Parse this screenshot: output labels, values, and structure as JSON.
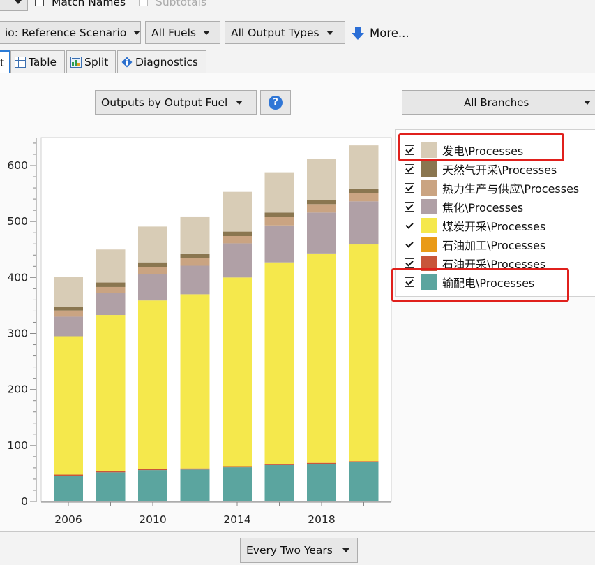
{
  "toolbar_top": {
    "match_names": "Match Names",
    "subtotals": "Subtotals"
  },
  "filters": {
    "scenario": "io: Reference Scenario",
    "fuels": "All Fuels",
    "output_types": "All Output Types",
    "more": "More..."
  },
  "tabs": [
    {
      "label": "t"
    },
    {
      "label": "Table"
    },
    {
      "label": "Split"
    },
    {
      "label": "Diagnostics"
    }
  ],
  "view_select": "Outputs by Output Fuel",
  "help": "?",
  "branches_select": "All Branches",
  "period_select": "Every Two Years",
  "colors": {
    "发电": "#d8ccb6",
    "天然气开采": "#8a7650",
    "热力生产与供应": "#caa482",
    "焦化": "#b0a0a6",
    "煤炭开采": "#f5e84c",
    "石油加工": "#e99a17",
    "石油开采": "#c8553a",
    "输配电": "#5ba59f",
    "highlight": "#e0201c"
  },
  "legend": [
    {
      "label": "发电\\Processes"
    },
    {
      "label": "天然气开采\\Processes"
    },
    {
      "label": "热力生产与供应\\Processes"
    },
    {
      "label": "焦化\\Processes"
    },
    {
      "label": "煤炭开采\\Processes"
    },
    {
      "label": "石油加工\\Processes"
    },
    {
      "label": "石油开采\\Processes"
    },
    {
      "label": "输配电\\Processes"
    }
  ],
  "chart_data": {
    "type": "bar",
    "stacked": true,
    "categories": [
      "2006",
      "2008",
      "2010",
      "2012",
      "2014",
      "2016",
      "2018",
      "2020"
    ],
    "x_tick_labels": [
      "2006",
      "2010",
      "2014",
      "2018"
    ],
    "ylim": [
      0,
      650
    ],
    "y_ticks": [
      0,
      100,
      200,
      300,
      400,
      500,
      600
    ],
    "series": [
      {
        "name": "输配电\\Processes",
        "color": "#5ba59f",
        "values": [
          46,
          52,
          56,
          57,
          61,
          65,
          67,
          70
        ]
      },
      {
        "name": "石油开采\\Processes",
        "color": "#c8553a",
        "values": [
          2,
          2,
          2,
          2,
          2,
          2,
          2,
          2
        ]
      },
      {
        "name": "石油加工\\Processes",
        "color": "#e99a17",
        "values": [
          0,
          0,
          0,
          0,
          0,
          0,
          0,
          0
        ]
      },
      {
        "name": "煤炭开采\\Processes",
        "color": "#f5e84c",
        "values": [
          247,
          279,
          301,
          311,
          337,
          360,
          374,
          387
        ]
      },
      {
        "name": "焦化\\Processes",
        "color": "#b0a0a6",
        "values": [
          35,
          39,
          47,
          51,
          61,
          66,
          73,
          77
        ]
      },
      {
        "name": "热力生产与供应\\Processes",
        "color": "#caa482",
        "values": [
          11,
          11,
          13,
          14,
          13,
          15,
          15,
          15
        ]
      },
      {
        "name": "天然气开采\\Processes",
        "color": "#8a7650",
        "values": [
          6,
          8,
          8,
          8,
          8,
          8,
          7,
          8
        ]
      },
      {
        "name": "发电\\Processes",
        "color": "#d8ccb6",
        "values": [
          54,
          59,
          64,
          66,
          71,
          72,
          74,
          77
        ]
      }
    ]
  }
}
